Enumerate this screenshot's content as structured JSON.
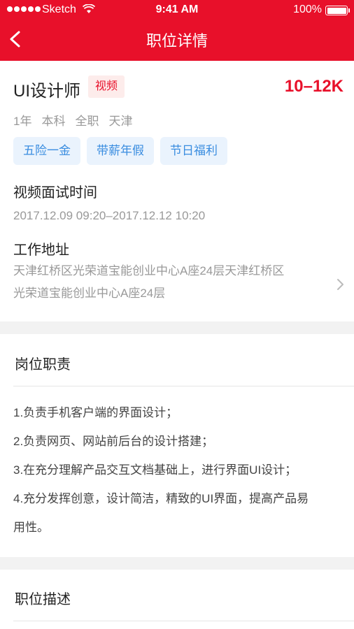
{
  "status": {
    "carrier": "Sketch",
    "time": "9:41 AM",
    "battery": "100%"
  },
  "nav": {
    "title": "职位详情"
  },
  "job": {
    "title": "UI设计师",
    "tag": "视频",
    "salary": "10–12K",
    "meta": [
      "1年",
      "本科",
      "全职",
      "天津"
    ],
    "benefits": [
      "五险一金",
      "带薪年假",
      "节日福利"
    ]
  },
  "interview": {
    "label": "视频面试时间",
    "value": "2017.12.09 09:20–2017.12.12 10:20"
  },
  "address": {
    "label": "工作地址",
    "line1": "天津红桥区光荣道宝能创业中心A座24层天津红桥区",
    "line2": "光荣道宝能创业中心A座24层"
  },
  "responsibilities": {
    "title": "岗位职责",
    "items": [
      "1.负责手机客户端的界面设计；",
      "2.负责网页、网站前后台的设计搭建；",
      "3.在充分理解产品交互文档基础上，进行界面UI设计；",
      "4.充分发挥创意，设计简洁，精致的UI界面，提高产品易",
      "用性。"
    ]
  },
  "description": {
    "title": "职位描述"
  },
  "colors": {
    "brand": "#e8102a",
    "benefit_text": "#3a8de0",
    "benefit_bg": "#eaf3fd"
  }
}
